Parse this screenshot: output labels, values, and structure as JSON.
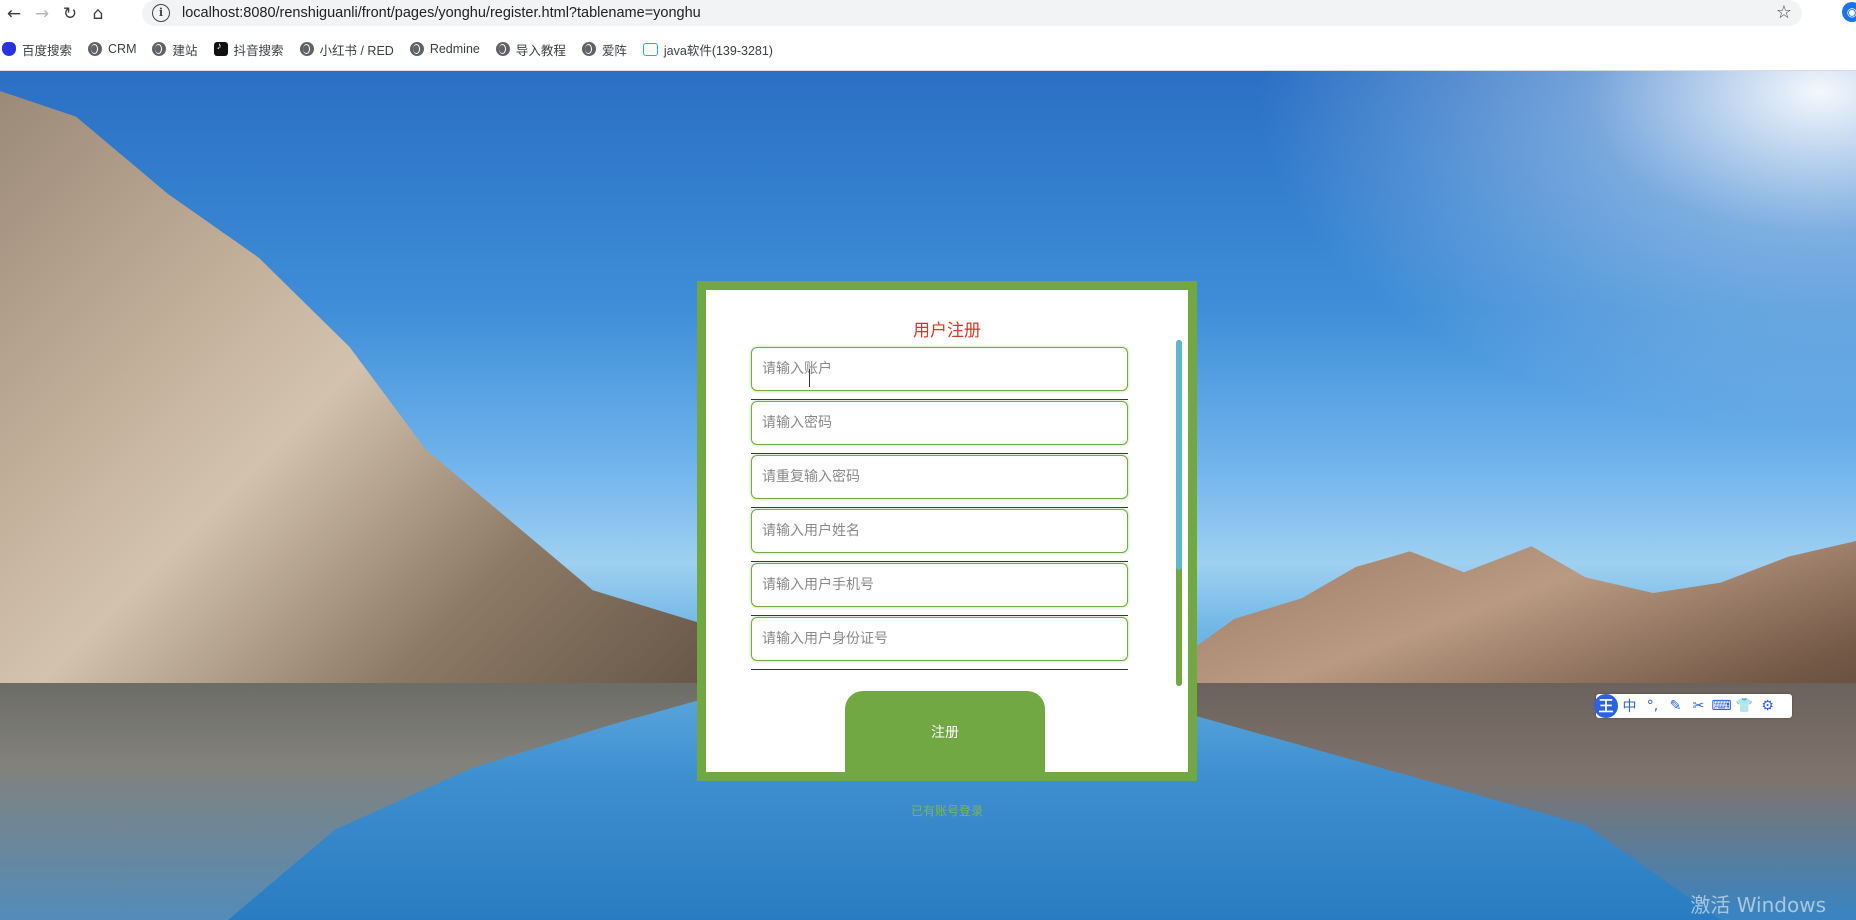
{
  "browser": {
    "url": "localhost:8080/renshiguanli/front/pages/yonghu/register.html?tablename=yonghu",
    "nav": {
      "back_icon": "←",
      "forward_icon": "→",
      "reload_icon": "↻",
      "home_icon": "⌂",
      "info_icon": "i",
      "star_icon": "☆",
      "profile_icon": "◉"
    },
    "bookmarks": [
      {
        "label": "百度搜索",
        "icon": "baidu-icon"
      },
      {
        "label": "CRM",
        "icon": "globe-icon"
      },
      {
        "label": "建站",
        "icon": "globe-icon"
      },
      {
        "label": "抖音搜索",
        "icon": "tiktok-icon"
      },
      {
        "label": "小红书 / RED",
        "icon": "globe-icon"
      },
      {
        "label": "Redmine",
        "icon": "globe-icon"
      },
      {
        "label": "导入教程",
        "icon": "globe-icon"
      },
      {
        "label": "爱阵",
        "icon": "globe-icon"
      },
      {
        "label": "java软件(139-3281)",
        "icon": "bilibili-icon"
      }
    ]
  },
  "register": {
    "title": "用户注册",
    "fields": [
      {
        "placeholder": "请输入账户",
        "value": ""
      },
      {
        "placeholder": "请输入密码",
        "value": ""
      },
      {
        "placeholder": "请重复输入密码",
        "value": ""
      },
      {
        "placeholder": "请输入用户姓名",
        "value": ""
      },
      {
        "placeholder": "请输入用户手机号",
        "value": ""
      },
      {
        "placeholder": "请输入用户身份证号",
        "value": ""
      }
    ],
    "submit_label": "注册",
    "login_link": "已有账号登录"
  },
  "ime": {
    "logo": "王",
    "items": [
      "中",
      "°,",
      "✎",
      "✂",
      "⌨",
      "👕",
      "⚙"
    ]
  },
  "watermark": "激活 Windows",
  "colors": {
    "accent_green": "#71a843",
    "title_red": "#d03c28",
    "scroll_thumb": "#5eb8c9",
    "link_green": "#7fb552"
  }
}
